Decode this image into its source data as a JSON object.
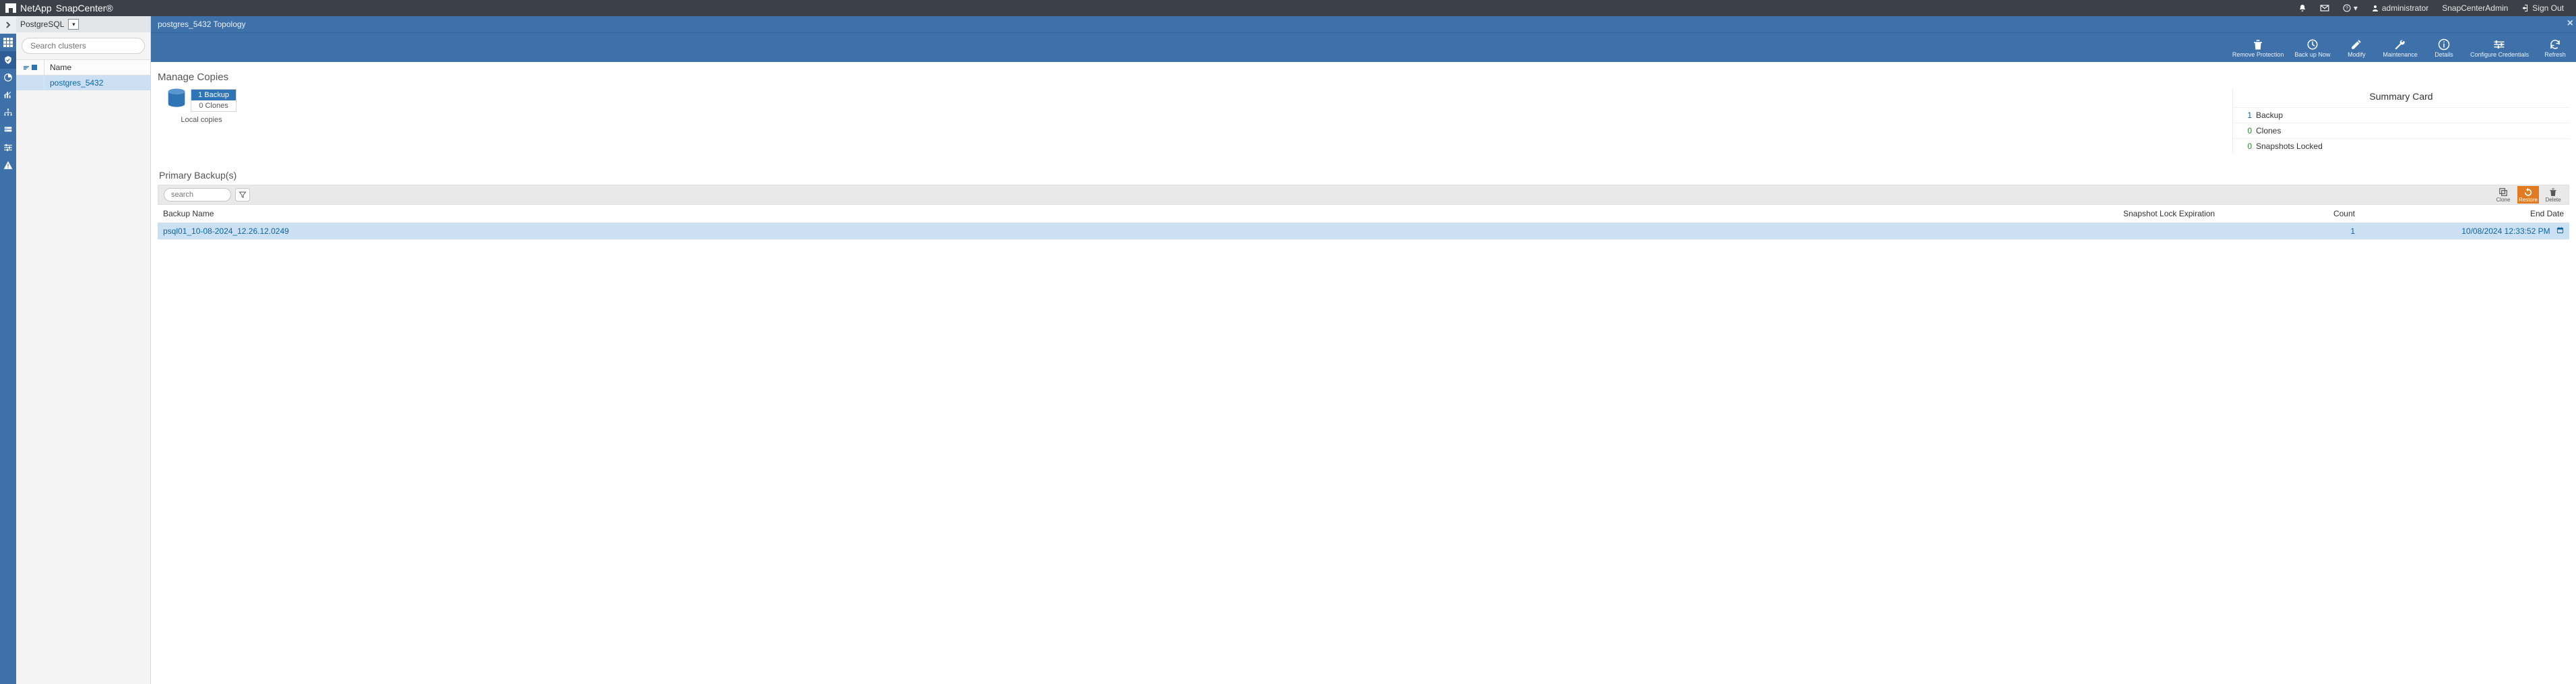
{
  "brand": {
    "name": "NetApp",
    "product": "SnapCenter®"
  },
  "topbar": {
    "help_label": "Help",
    "user_prefix_icon": "user",
    "user": "administrator",
    "role": "SnapCenterAdmin",
    "signout": "Sign Out"
  },
  "sidebar": {
    "plugin": "PostgreSQL",
    "search_placeholder": "Search clusters",
    "col_name": "Name",
    "rows": [
      {
        "name": "postgres_5432"
      }
    ]
  },
  "breadcrumb": "postgres_5432 Topology",
  "actions": {
    "remove_protection": "Remove Protection",
    "backup_now": "Back up Now",
    "modify": "Modify",
    "maintenance": "Maintenance",
    "details": "Details",
    "configure_credentials": "Configure Credentials",
    "refresh": "Refresh"
  },
  "manage_copies": {
    "title": "Manage Copies",
    "backup_badge": "1 Backup",
    "clone_line": "0 Clones",
    "local_copies": "Local copies"
  },
  "summary": {
    "title": "Summary Card",
    "lines": [
      {
        "n": "1",
        "label": "Backup",
        "cls": "blue"
      },
      {
        "n": "0",
        "label": "Clones",
        "cls": "green"
      },
      {
        "n": "0",
        "label": "Snapshots Locked",
        "cls": "green"
      }
    ]
  },
  "primary_backups": {
    "title": "Primary Backup(s)",
    "search_placeholder": "search",
    "toolbar": {
      "clone": "Clone",
      "restore": "Restore",
      "delete": "Delete"
    },
    "cols": {
      "name": "Backup Name",
      "snap": "Snapshot Lock Expiration",
      "count": "Count",
      "end": "End Date"
    },
    "rows": [
      {
        "name": "psql01_10-08-2024_12.26.12.0249",
        "snap": "",
        "count": "1",
        "end": "10/08/2024 12:33:52 PM"
      }
    ]
  }
}
